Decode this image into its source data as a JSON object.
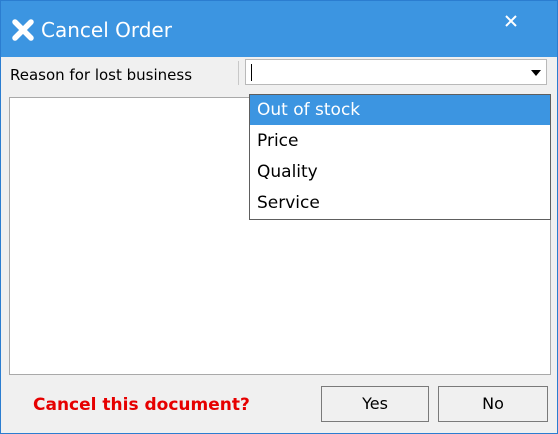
{
  "window": {
    "title": "Cancel Order",
    "title_icon": "x-icon",
    "close_icon": "close-icon",
    "accent_color": "#3c95e1"
  },
  "form": {
    "reason_label": "Reason for lost business",
    "reason_value": "",
    "dropdown_arrow_icon": "chevron-down-icon",
    "dropdown_options": [
      "Out of stock",
      "Price",
      "Quality",
      "Service"
    ],
    "highlighted_option": "Out of stock",
    "notes_value": ""
  },
  "footer": {
    "confirm_text": "Cancel this document?",
    "confirm_color": "#e60000",
    "yes_label": "Yes",
    "no_label": "No"
  }
}
